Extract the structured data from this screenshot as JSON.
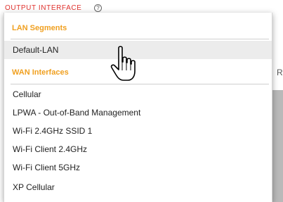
{
  "field": {
    "label": "OUTPUT INTERFACE",
    "help_icon": "question-circle-icon",
    "help_glyph": "?"
  },
  "background": {
    "fragment": "R"
  },
  "dropdown": {
    "groups": [
      {
        "header": "LAN Segments",
        "options": [
          "Default-LAN"
        ]
      },
      {
        "header": "WAN Interfaces",
        "options": [
          "Cellular",
          "LPWA - Out-of-Band Management",
          "Wi-Fi 2.4GHz SSID 1",
          "Wi-Fi Client 2.4GHz",
          "Wi-Fi Client 5GHz",
          "XP Cellular"
        ]
      }
    ],
    "hovered_option": "Default-LAN"
  },
  "cursor": {
    "icon": "hand-pointer-icon"
  },
  "colors": {
    "label": "#e0312d",
    "group_header": "#f0a020",
    "hover": "#ececec"
  }
}
